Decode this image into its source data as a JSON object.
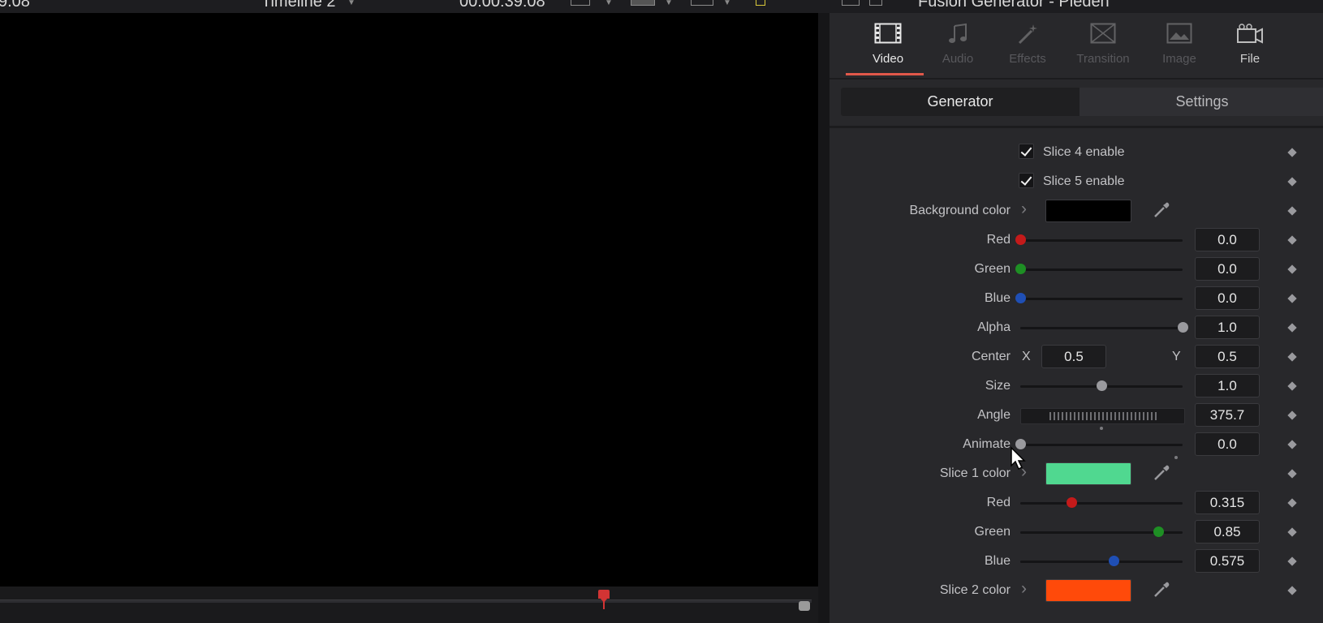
{
  "topbar": {
    "left_value": "9.08",
    "timeline": "Timeline 2",
    "timecode": "00:00:39:08",
    "title": "Fusion Generator - Pieden"
  },
  "inspector": {
    "tabs": [
      {
        "label": "Video",
        "icon": "filmstrip-icon",
        "active": true
      },
      {
        "label": "Audio",
        "icon": "music-note-icon",
        "active": false
      },
      {
        "label": "Effects",
        "icon": "magic-wand-icon",
        "active": false
      },
      {
        "label": "Transition",
        "icon": "transition-icon",
        "active": false
      },
      {
        "label": "Image",
        "icon": "image-icon",
        "active": false
      },
      {
        "label": "File",
        "icon": "camera-icon",
        "active": false
      }
    ],
    "segments": {
      "generator": "Generator",
      "settings": "Settings"
    },
    "params": {
      "slice4_enable": {
        "label": "Slice 4 enable",
        "checked": true
      },
      "slice5_enable": {
        "label": "Slice 5 enable",
        "checked": true
      },
      "background_color": {
        "label": "Background color",
        "color": "#000000"
      },
      "bg_red": {
        "label": "Red",
        "value": "0.0",
        "level": 0.0,
        "dot": "#c41a1a"
      },
      "bg_green": {
        "label": "Green",
        "value": "0.0",
        "level": 0.0,
        "dot": "#1e8f24"
      },
      "bg_blue": {
        "label": "Blue",
        "value": "0.0",
        "level": 0.0,
        "dot": "#1f4fb5"
      },
      "alpha": {
        "label": "Alpha",
        "value": "1.0",
        "level": 1.0,
        "dot": "#9a9a9e"
      },
      "center": {
        "label": "Center",
        "x_label": "X",
        "x": "0.5",
        "y_label": "Y",
        "y": "0.5"
      },
      "size": {
        "label": "Size",
        "value": "1.0",
        "level": 0.5,
        "dot": "#9a9a9e"
      },
      "angle": {
        "label": "Angle",
        "value": "375.7"
      },
      "animate": {
        "label": "Animate",
        "value": "0.0",
        "level": 0.0,
        "dot": "#9a9a9e"
      },
      "slice1_color": {
        "label": "Slice 1 color",
        "color": "#50d890"
      },
      "s1_red": {
        "label": "Red",
        "value": "0.315",
        "level": 0.315,
        "dot": "#c41a1a"
      },
      "s1_green": {
        "label": "Green",
        "value": "0.85",
        "level": 0.85,
        "dot": "#1e8f24"
      },
      "s1_blue": {
        "label": "Blue",
        "value": "0.575",
        "level": 0.575,
        "dot": "#1f4fb5"
      },
      "slice2_color": {
        "label": "Slice 2 color",
        "color": "#ff4a0a"
      }
    }
  }
}
